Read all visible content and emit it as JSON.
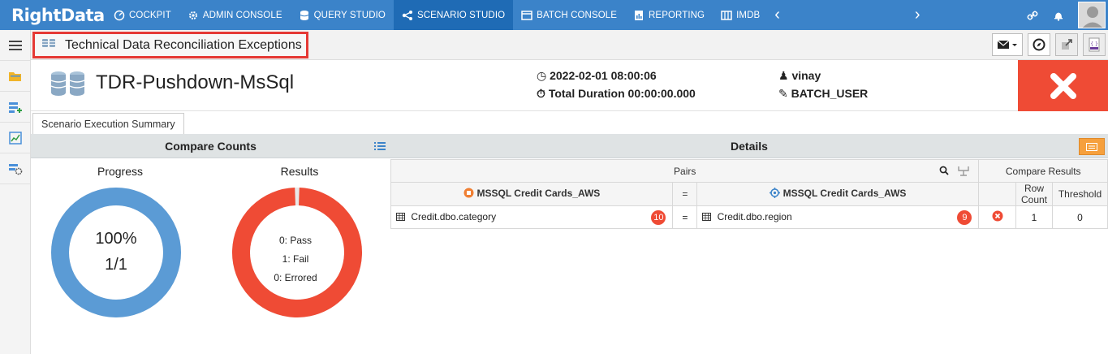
{
  "app": {
    "logo": "RightData"
  },
  "nav": {
    "items": [
      {
        "label": "COCKPIT",
        "icon": "cockpit-icon"
      },
      {
        "label": "ADMIN CONSOLE",
        "icon": "gear-icon"
      },
      {
        "label": "QUERY STUDIO",
        "icon": "database-icon"
      },
      {
        "label": "SCENARIO STUDIO",
        "icon": "scenario-icon",
        "active": true
      },
      {
        "label": "BATCH CONSOLE",
        "icon": "batch-icon"
      },
      {
        "label": "REPORTING",
        "icon": "report-icon"
      },
      {
        "label": "IMDB",
        "icon": "imdb-icon"
      }
    ]
  },
  "titlebar": {
    "title": "Technical Data Reconciliation Exceptions"
  },
  "scenario": {
    "name": "TDR-Pushdown-MsSql",
    "datetime": "2022-02-01 08:00:06",
    "duration": "Total Duration 00:00:00.000",
    "user": "vinay",
    "batch_user": "BATCH_USER",
    "status": "failed"
  },
  "tabs": {
    "summary": "Scenario Execution Summary"
  },
  "compare_counts": {
    "header": "Compare Counts",
    "progress_label": "Progress",
    "progress_percent": "100%",
    "progress_fraction": "1/1",
    "progress_value": 1.0,
    "results_label": "Results",
    "pass": "0: Pass",
    "fail": "1: Fail",
    "errored": "0: Errored",
    "fail_fraction": 1.0
  },
  "details": {
    "header": "Details",
    "pairs_header": "Pairs",
    "compare_results_header": "Compare Results",
    "source_header": "MSSQL Credit Cards_AWS",
    "eq": "=",
    "target_header": "MSSQL Credit Cards_AWS",
    "row_count_header": "Row Count",
    "threshold_header": "Threshold",
    "rows": [
      {
        "source_table": "Credit.dbo.category",
        "source_count": "10",
        "eq": "=",
        "target_table": "Credit.dbo.region",
        "target_count": "9",
        "row_count": "1",
        "threshold": "0"
      }
    ]
  },
  "colors": {
    "nav": "#3b83c9",
    "nav_active": "#1f6bb5",
    "progress": "#5b9bd5",
    "fail": "#ef4b35",
    "accent": "#f6a03d"
  }
}
